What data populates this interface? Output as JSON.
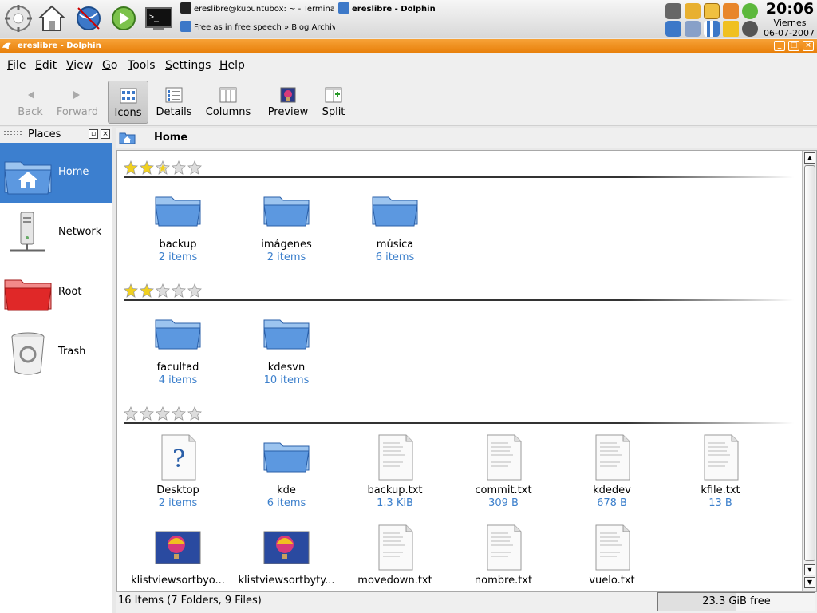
{
  "taskbar": {
    "tasks": [
      {
        "label": "ereslibre@kubuntubox: ~ - Terminal",
        "active": false
      },
      {
        "label": "ereslibre - Dolphin",
        "active": true
      },
      {
        "label": "Free as in free speech » Blog Archiv",
        "active": false
      }
    ],
    "clock": {
      "time": "20:06",
      "day": "Viernes",
      "date": "06-07-2007"
    }
  },
  "window": {
    "title": "ereslibre - Dolphin"
  },
  "menu": [
    {
      "u": "F",
      "rest": "ile"
    },
    {
      "u": "E",
      "rest": "dit"
    },
    {
      "u": "V",
      "rest": "iew"
    },
    {
      "u": "G",
      "rest": "o"
    },
    {
      "u": "T",
      "rest": "ools"
    },
    {
      "u": "S",
      "rest": "ettings"
    },
    {
      "u": "H",
      "rest": "elp"
    }
  ],
  "toolbar": {
    "back": "Back",
    "forward": "Forward",
    "icons": "Icons",
    "details": "Details",
    "columns": "Columns",
    "preview": "Preview",
    "split": "Split"
  },
  "places": {
    "title": "Places",
    "items": [
      {
        "label": "Home"
      },
      {
        "label": "Network"
      },
      {
        "label": "Root"
      },
      {
        "label": "Trash"
      }
    ]
  },
  "location": {
    "text": "Home"
  },
  "groups": [
    {
      "rating": 2.5,
      "items": [
        {
          "name": "backup",
          "meta": "2 items",
          "type": "folder"
        },
        {
          "name": "imágenes",
          "meta": "2 items",
          "type": "folder"
        },
        {
          "name": "música",
          "meta": "6 items",
          "type": "folder"
        }
      ]
    },
    {
      "rating": 2,
      "items": [
        {
          "name": "facultad",
          "meta": "4 items",
          "type": "folder"
        },
        {
          "name": "kdesvn",
          "meta": "10 items",
          "type": "folder"
        }
      ]
    },
    {
      "rating": 0,
      "items": [
        {
          "name": "Desktop",
          "meta": "2 items",
          "type": "unknown"
        },
        {
          "name": "kde",
          "meta": "6 items",
          "type": "folder"
        },
        {
          "name": "backup.txt",
          "meta": "1.3 KiB",
          "type": "text"
        },
        {
          "name": "commit.txt",
          "meta": "309 B",
          "type": "text"
        },
        {
          "name": "kdedev",
          "meta": "678 B",
          "type": "text"
        },
        {
          "name": "kfile.txt",
          "meta": "13 B",
          "type": "text"
        },
        {
          "name": "klistviewsortbyo...",
          "meta": "",
          "type": "image"
        },
        {
          "name": "klistviewsortbyty...",
          "meta": "",
          "type": "image"
        },
        {
          "name": "movedown.txt",
          "meta": "",
          "type": "text"
        },
        {
          "name": "nombre.txt",
          "meta": "",
          "type": "text"
        },
        {
          "name": "vuelo.txt",
          "meta": "",
          "type": "text"
        }
      ]
    }
  ],
  "status": {
    "text": "16 Items (7 Folders, 9 Files)",
    "free": "23.3 GiB free",
    "free_fraction": 0.5
  }
}
